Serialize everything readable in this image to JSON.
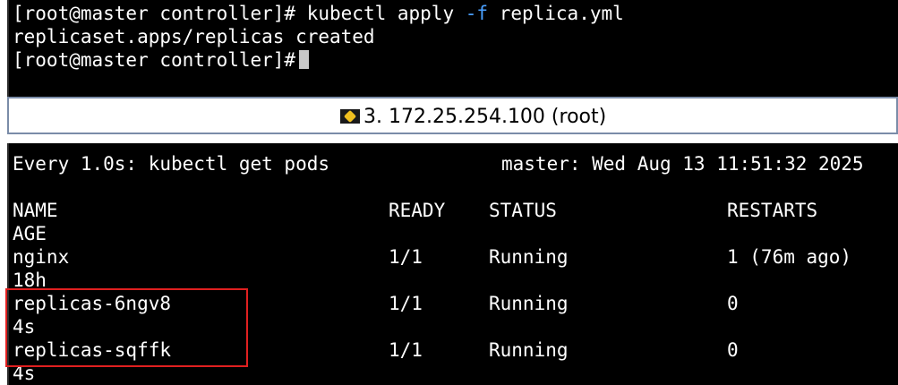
{
  "top_terminal": {
    "prompt": "[root@master controller]#",
    "command": "kubectl apply ",
    "flag": "-f",
    "argument": " replica.yml",
    "output": "replicaset.apps/replicas created",
    "prompt2": "[root@master controller]#"
  },
  "tab": {
    "title": "3. 172.25.254.100 (root)",
    "icon": "key-icon"
  },
  "watch": {
    "header_left": "Every 1.0s: kubectl get pods",
    "header_right": "master: Wed Aug 13 11:51:32 2025",
    "columns": [
      "NAME",
      "READY",
      "STATUS",
      "RESTARTS",
      "AGE"
    ],
    "rows": [
      {
        "name": "nginx",
        "ready": "1/1",
        "status": "Running",
        "restarts": "1 (76m ago)",
        "age": "18h"
      },
      {
        "name": "replicas-6ngv8",
        "ready": "1/1",
        "status": "Running",
        "restarts": "0",
        "age": "4s"
      },
      {
        "name": "replicas-sqffk",
        "ready": "1/1",
        "status": "Running",
        "restarts": "0",
        "age": "4s"
      }
    ]
  },
  "colors": {
    "background": "#000000",
    "text": "#ffffff",
    "flag": "#4aa0ff",
    "highlight_box": "#e02020"
  }
}
